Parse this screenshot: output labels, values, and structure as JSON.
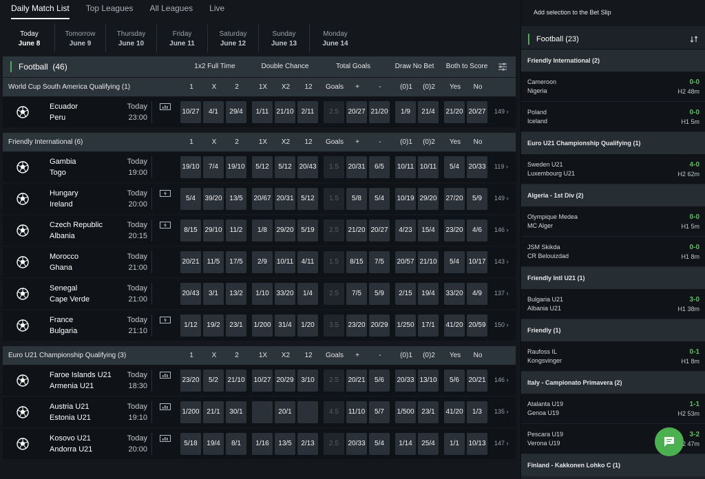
{
  "nav": {
    "tabs": [
      "Daily Match List",
      "Top Leagues",
      "All Leagues",
      "Live"
    ]
  },
  "dates": [
    {
      "day": "Today",
      "date": "June 8"
    },
    {
      "day": "Tomorrow",
      "date": "June 9"
    },
    {
      "day": "Thursday",
      "date": "June 10"
    },
    {
      "day": "Friday",
      "date": "June 11"
    },
    {
      "day": "Saturday",
      "date": "June 12"
    },
    {
      "day": "Sunday",
      "date": "June 13"
    },
    {
      "day": "Monday",
      "date": "June 14"
    }
  ],
  "sport": {
    "title": "Football",
    "count": "(46)",
    "markets": [
      "1x2 Full Time",
      "Double Chance",
      "Total Goals",
      "Draw No Bet",
      "Both to Score"
    ]
  },
  "col_labels": [
    "1",
    "X",
    "2",
    "1X",
    "X2",
    "12",
    "Goals",
    "+",
    "-",
    "(0)1",
    "(0)2",
    "Yes",
    "No"
  ],
  "groups": [
    {
      "name": "World Cup South America Qualifying (1)",
      "matches": [
        {
          "home": "Ecuador",
          "away": "Peru",
          "day": "Today",
          "time": "23:00",
          "icon": "stats",
          "odds": [
            "10/27",
            "4/1",
            "29/4",
            "1/11",
            "21/10",
            "2/11",
            "2.5",
            "20/27",
            "21/20",
            "1/9",
            "21/4",
            "21/20",
            "20/27"
          ],
          "more": "149"
        }
      ]
    },
    {
      "name": "Friendly International (6)",
      "matches": [
        {
          "home": "Gambia",
          "away": "Togo",
          "day": "Today",
          "time": "19:00",
          "icon": "",
          "odds": [
            "19/10",
            "7/4",
            "19/10",
            "5/12",
            "5/12",
            "20/43",
            "1.5",
            "20/31",
            "6/5",
            "10/11",
            "10/11",
            "5/4",
            "20/33"
          ],
          "more": "119"
        },
        {
          "home": "Hungary",
          "away": "Ireland",
          "day": "Today",
          "time": "20:00",
          "icon": "live",
          "odds": [
            "5/4",
            "39/20",
            "13/5",
            "20/67",
            "20/31",
            "5/12",
            "1.5",
            "5/8",
            "5/4",
            "10/19",
            "29/20",
            "27/20",
            "5/9"
          ],
          "more": "149"
        },
        {
          "home": "Czech Republic",
          "away": "Albania",
          "day": "Today",
          "time": "20:15",
          "icon": "live",
          "odds": [
            "8/15",
            "29/10",
            "11/2",
            "1/8",
            "29/20",
            "5/19",
            "2.5",
            "21/20",
            "20/27",
            "4/23",
            "15/4",
            "23/20",
            "4/6"
          ],
          "more": "146"
        },
        {
          "home": "Morocco",
          "away": "Ghana",
          "day": "Today",
          "time": "21:00",
          "icon": "",
          "odds": [
            "20/21",
            "11/5",
            "17/5",
            "2/9",
            "10/11",
            "4/11",
            "1.5",
            "8/15",
            "7/5",
            "20/57",
            "21/10",
            "5/4",
            "10/17"
          ],
          "more": "143"
        },
        {
          "home": "Senegal",
          "away": "Cape Verde",
          "day": "Today",
          "time": "21:00",
          "icon": "",
          "odds": [
            "20/43",
            "3/1",
            "13/2",
            "1/10",
            "33/20",
            "1/4",
            "2.5",
            "7/5",
            "5/9",
            "2/15",
            "19/4",
            "33/20",
            "4/9"
          ],
          "more": "137"
        },
        {
          "home": "France",
          "away": "Bulgaria",
          "day": "Today",
          "time": "21:10",
          "icon": "live",
          "odds": [
            "1/12",
            "19/2",
            "23/1",
            "1/200",
            "31/4",
            "1/20",
            "3.5",
            "23/20",
            "20/29",
            "1/250",
            "17/1",
            "41/20",
            "20/59"
          ],
          "more": "150"
        }
      ]
    },
    {
      "name": "Euro U21 Championship Qualifying (3)",
      "matches": [
        {
          "home": "Faroe Islands U21",
          "away": "Armenia U21",
          "day": "Today",
          "time": "18:30",
          "icon": "stats",
          "odds": [
            "23/20",
            "5/2",
            "21/10",
            "10/27",
            "20/29",
            "3/10",
            "2.5",
            "20/21",
            "5/6",
            "20/33",
            "13/10",
            "5/6",
            "20/21"
          ],
          "more": "146"
        },
        {
          "home": "Austria U21",
          "away": "Estonia U21",
          "day": "Today",
          "time": "19:10",
          "icon": "stats",
          "odds": [
            "1/200",
            "21/1",
            "30/1",
            "",
            "20/1",
            "",
            "4.5",
            "11/10",
            "5/7",
            "1/500",
            "23/1",
            "41/20",
            "1/3"
          ],
          "more": "135"
        },
        {
          "home": "Kosovo U21",
          "away": "Andorra U21",
          "day": "Today",
          "time": "20:00",
          "icon": "stats",
          "odds": [
            "5/18",
            "19/4",
            "8/1",
            "1/16",
            "13/5",
            "2/13",
            "2.5",
            "20/33",
            "5/4",
            "1/14",
            "25/4",
            "1/1",
            "10/13"
          ],
          "more": "147"
        }
      ]
    }
  ],
  "betslip": {
    "text": "Add selection to the Bet Slip"
  },
  "live": {
    "title": "Football",
    "count": "(23)",
    "groups": [
      {
        "name": "Friendly International (2)",
        "matches": [
          {
            "a": "Cameroon",
            "b": "Nigeria",
            "score": "0-0",
            "minute": "H2 48m"
          },
          {
            "a": "Poland",
            "b": "Iceland",
            "score": "0-0",
            "minute": "H1 5m"
          }
        ]
      },
      {
        "name": "Euro U21 Championship Qualifying (1)",
        "matches": [
          {
            "a": "Sweden U21",
            "b": "Luxembourg U21",
            "score": "4-0",
            "minute": "H2 62m"
          }
        ]
      },
      {
        "name": "Algeria - 1st Div (2)",
        "matches": [
          {
            "a": "Olympique Medea",
            "b": "MC Alger",
            "score": "0-0",
            "minute": "H1 5m"
          },
          {
            "a": "JSM Skikda",
            "b": "CR Belouizdad",
            "score": "0-0",
            "minute": "H1 8m"
          }
        ]
      },
      {
        "name": "Friendly Intl U21 (1)",
        "matches": [
          {
            "a": "Bulgaria U21",
            "b": "Albania U21",
            "score": "3-0",
            "minute": "H1 38m"
          }
        ]
      },
      {
        "name": "Friendly (1)",
        "matches": [
          {
            "a": "Raufoss IL",
            "b": "Kongsvinger",
            "score": "0-1",
            "minute": "H1 8m"
          }
        ]
      },
      {
        "name": "Italy - Campionato Primavera (2)",
        "matches": [
          {
            "a": "Atalanta U19",
            "b": "Genoa U19",
            "score": "1-1",
            "minute": "H2 53m"
          },
          {
            "a": "Pescara U19",
            "b": "Verona U19",
            "score": "3-2",
            "minute": "H2 47m"
          }
        ]
      },
      {
        "name": "Finland - Kakkonen Lohko C (1)",
        "matches": []
      }
    ]
  },
  "colors": {
    "accent": "#4caf50",
    "row": "#0f1317",
    "odd": "#2a3138",
    "header": "#2c343c"
  }
}
